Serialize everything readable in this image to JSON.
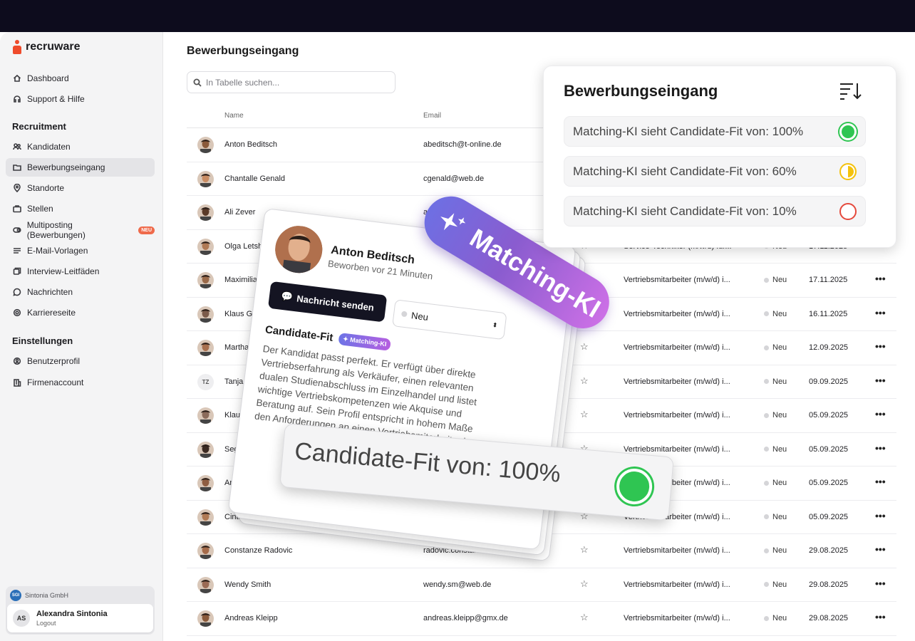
{
  "brand": {
    "name": "recruware"
  },
  "page": {
    "title": "Bewerbungseingang"
  },
  "sidebar": {
    "top_items": [
      {
        "label": "Dashboard",
        "icon": "home-icon"
      },
      {
        "label": "Support & Hilfe",
        "icon": "headset-icon"
      }
    ],
    "section_recruitment": "Recruitment",
    "recruitment_items": [
      {
        "label": "Kandidaten",
        "icon": "users-icon"
      },
      {
        "label": "Bewerbungseingang",
        "icon": "inbox-folder-icon",
        "active": true
      },
      {
        "label": "Standorte",
        "icon": "map-pin-icon"
      },
      {
        "label": "Stellen",
        "icon": "briefcase-icon"
      },
      {
        "label": "Multiposting (Bewerbungen)",
        "icon": "toggle-icon",
        "badge": "NEU"
      },
      {
        "label": "E-Mail-Vorlagen",
        "icon": "list-icon"
      },
      {
        "label": "Interview-Leitfäden",
        "icon": "copy-icon"
      },
      {
        "label": "Nachrichten",
        "icon": "chat-icon"
      },
      {
        "label": "Karriereseite",
        "icon": "gear-icon"
      }
    ],
    "section_settings": "Einstellungen",
    "settings_items": [
      {
        "label": "Benutzerprofil",
        "icon": "settings-user-icon"
      },
      {
        "label": "Firmenaccount",
        "icon": "building-icon"
      }
    ],
    "org": {
      "name": "Sintonia GmbH"
    },
    "user": {
      "initials": "AS",
      "name": "Alexandra Sintonia",
      "logout": "Logout"
    }
  },
  "search": {
    "placeholder": "In Tabelle suchen..."
  },
  "table": {
    "headers": {
      "name": "Name",
      "email": "Email"
    },
    "rows": [
      {
        "name": "Anton Beditsch",
        "email": "abeditsch@t-online.de",
        "job": "",
        "status": "",
        "date": ""
      },
      {
        "name": "Chantalle Genald",
        "email": "cgenald@web.de",
        "job": "",
        "status": "",
        "date": ""
      },
      {
        "name": "Ali Zever",
        "email": "azever",
        "job": "",
        "status": "",
        "date": ""
      },
      {
        "name": "Olga Letshkov",
        "email": "",
        "job": "Service-Techniker (m/w/d) für...",
        "status": "Neu",
        "date": "17.11.2025"
      },
      {
        "name": "Maximilian Kenn",
        "email": "",
        "job": "Vertriebsmitarbeiter (m/w/d) i...",
        "status": "Neu",
        "date": "17.11.2025"
      },
      {
        "name": "Klaus Grosstag",
        "email": "",
        "job": "Vertriebsmitarbeiter (m/w/d) i...",
        "status": "Neu",
        "date": "16.11.2025"
      },
      {
        "name": "Martha Tertz",
        "email": "",
        "job": "Vertriebsmitarbeiter (m/w/d) i...",
        "status": "Neu",
        "date": "12.09.2025"
      },
      {
        "name": "Tanja Zeitl",
        "email": "",
        "initials": "TZ",
        "job": "Vertriebsmitarbeiter (m/w/d) i...",
        "status": "Neu",
        "date": "09.09.2025"
      },
      {
        "name": "Klaus Gros",
        "email": "",
        "job": "Vertriebsmitarbeiter (m/w/d) i...",
        "status": "Neu",
        "date": "05.09.2025"
      },
      {
        "name": "Segowni",
        "email": "",
        "job": "Vertriebsmitarbeiter (m/w/d) i...",
        "status": "Neu",
        "date": "05.09.2025"
      },
      {
        "name": "Angus F",
        "email": "",
        "job": "Vertriebsmitarbeiter (m/w/d) i...",
        "status": "Neu",
        "date": "05.09.2025"
      },
      {
        "name": "Cintia Alvarez",
        "email": "",
        "job": "Vertriebsmitarbeiter (m/w/d) i...",
        "status": "Neu",
        "date": "05.09.2025"
      },
      {
        "name": "Constanze Radovic",
        "email": "radovic.constan",
        "job": "Vertriebsmitarbeiter (m/w/d) i...",
        "status": "Neu",
        "date": "29.08.2025"
      },
      {
        "name": "Wendy Smith",
        "email": "wendy.sm@web.de",
        "job": "Vertriebsmitarbeiter (m/w/d) i...",
        "status": "Neu",
        "date": "29.08.2025"
      },
      {
        "name": "Andreas Kleipp",
        "email": "andreas.kleipp@gmx.de",
        "job": "Vertriebsmitarbeiter (m/w/d) i...",
        "status": "Neu",
        "date": "29.08.2025"
      }
    ],
    "more_label": "•••",
    "star_label": "☆"
  },
  "matching_panel": {
    "title": "Bewerbungseingang",
    "items": [
      {
        "label": "Matching-KI sieht Candidate-Fit von: 100%",
        "color": "#2fc552",
        "fill": 1.0
      },
      {
        "label": "Matching-KI sieht Candidate-Fit von: 60%",
        "color": "#f4c20d",
        "fill": 0.6
      },
      {
        "label": "Matching-KI sieht Candidate-Fit von: 10%",
        "color": "#e5483b",
        "fill": 0.1
      }
    ]
  },
  "candidate_card": {
    "name": "Anton Beditsch",
    "applied": "Beworben vor 21 Minuten",
    "message_button": "Nachricht senden",
    "status_value": "Neu",
    "section_title": "Candidate-Fit",
    "ki_badge": "Matching-KI",
    "text": "Der Kandidat passt perfekt. Er verfügt über direkte Vertriebserfahrung als Verkäufer, einen relevanten dualen Studienabschluss im Einzelhandel und listet wichtige Vertriebskompetenzen wie Akquise und Beratung auf. Sein Profil entspricht in hohem Maße den Anforderungen an einen Vertriebsmitarbeiter im"
  },
  "fit_pill": {
    "label": "Candidate-Fit von: 100%",
    "color": "#2fc552"
  },
  "ki_pill": {
    "label": "Matching-KI"
  },
  "colors": {
    "accent": "#ef4b2c",
    "dark": "#141422",
    "ki_start": "#6e6fe3",
    "ki_end": "#cc70e6"
  }
}
